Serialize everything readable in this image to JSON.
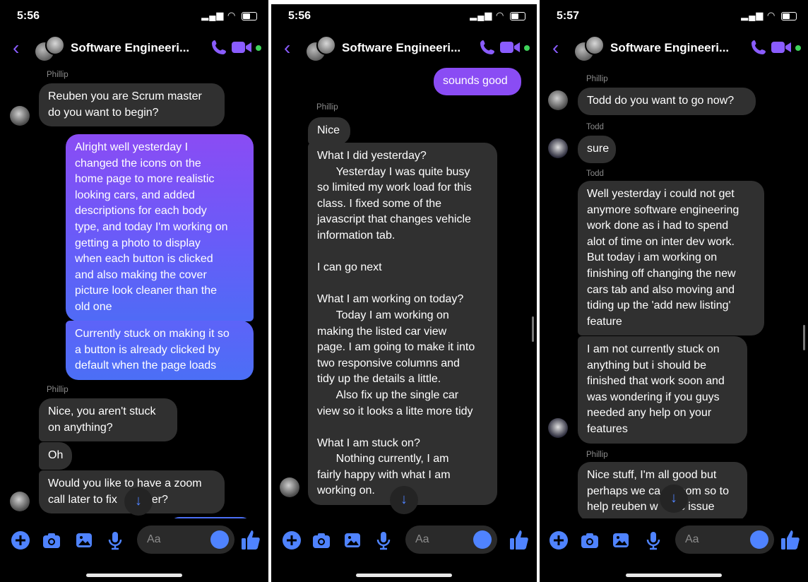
{
  "colors": {
    "accent": "#8a5cff",
    "outgoing_top": "#8a4cf4",
    "outgoing_bottom": "#4f6bf6",
    "incoming": "#303030",
    "online": "#3fd35a",
    "icon_blue": "#4f83ff"
  },
  "panels": [
    {
      "status_time": "5:56",
      "title": "Software Engineeri...",
      "composer_placeholder": "Aa",
      "messages": [
        {
          "sender": "Phillip"
        },
        {
          "text": "Reuben you are Scrum master\ndo you want to begin?"
        },
        {
          "text": "Alright well yesterday I\nchanged the icons on the\nhome page to more realistic\nlooking cars, and added\ndescriptions for each body\ntype, and today I'm working on\ngetting a photo to display\nwhen each button is clicked\nand also making the cover\npicture look cleaner than the\nold one"
        },
        {
          "text": "Currently stuck on making it so\na button is already clicked by\ndefault when the page loads"
        },
        {
          "sender": "Phillip"
        },
        {
          "text": "Nice, you aren't stuck\non anything?"
        },
        {
          "text": "Oh"
        },
        {
          "text": "Would you like to have a zoom\ncall later to fix    gether?"
        }
      ]
    },
    {
      "status_time": "5:56",
      "title": "Software Engineeri...",
      "composer_placeholder": "Aa",
      "messages": [
        {
          "text": "sounds good"
        },
        {
          "sender": "Phillip"
        },
        {
          "text": "Nice"
        },
        {
          "text": "What I did yesterday?\n      Yesterday I was quite busy\nso limited my work load for this\nclass. I fixed some of the\njavascript that changes vehicle\ninformation tab.\n\nI can go next\n\nWhat I am working on today?\n      Today I am working on\nmaking the listed car view\npage. I am going to make it into\ntwo responsive columns and\ntidy up the details a little.\n      Also fix up the single car\nview so it looks a litte more tidy\n\nWhat I am stuck on?\n      Nothing currently, I am\nfairly happy with what I am\nworking on."
        }
      ]
    },
    {
      "status_time": "5:57",
      "title": "Software Engineeri...",
      "composer_placeholder": "Aa",
      "messages": [
        {
          "sender": "Phillip"
        },
        {
          "text": "Todd do you want to go now?"
        },
        {
          "sender": "Todd"
        },
        {
          "text": "sure"
        },
        {
          "sender": "Todd"
        },
        {
          "text": "Well yesterday i could not get\nanymore software engineering\nwork done as i had to spend\nalot of time on inter dev work.\nBut today i am working on\nfinishing off changing the new\ncars tab and also moving and\ntiding up the 'add new listing'\nfeature"
        },
        {
          "text": "I am not currently stuck on\nanything but i should be\nfinished that work soon and\nwas wondering if you guys\nneeded any help on your\nfeatures"
        },
        {
          "sender": "Phillip"
        },
        {
          "text": "Nice stuff, I'm all good but\nperhaps we ca      oom so to\nhelp reuben w      is issue"
        }
      ]
    }
  ]
}
